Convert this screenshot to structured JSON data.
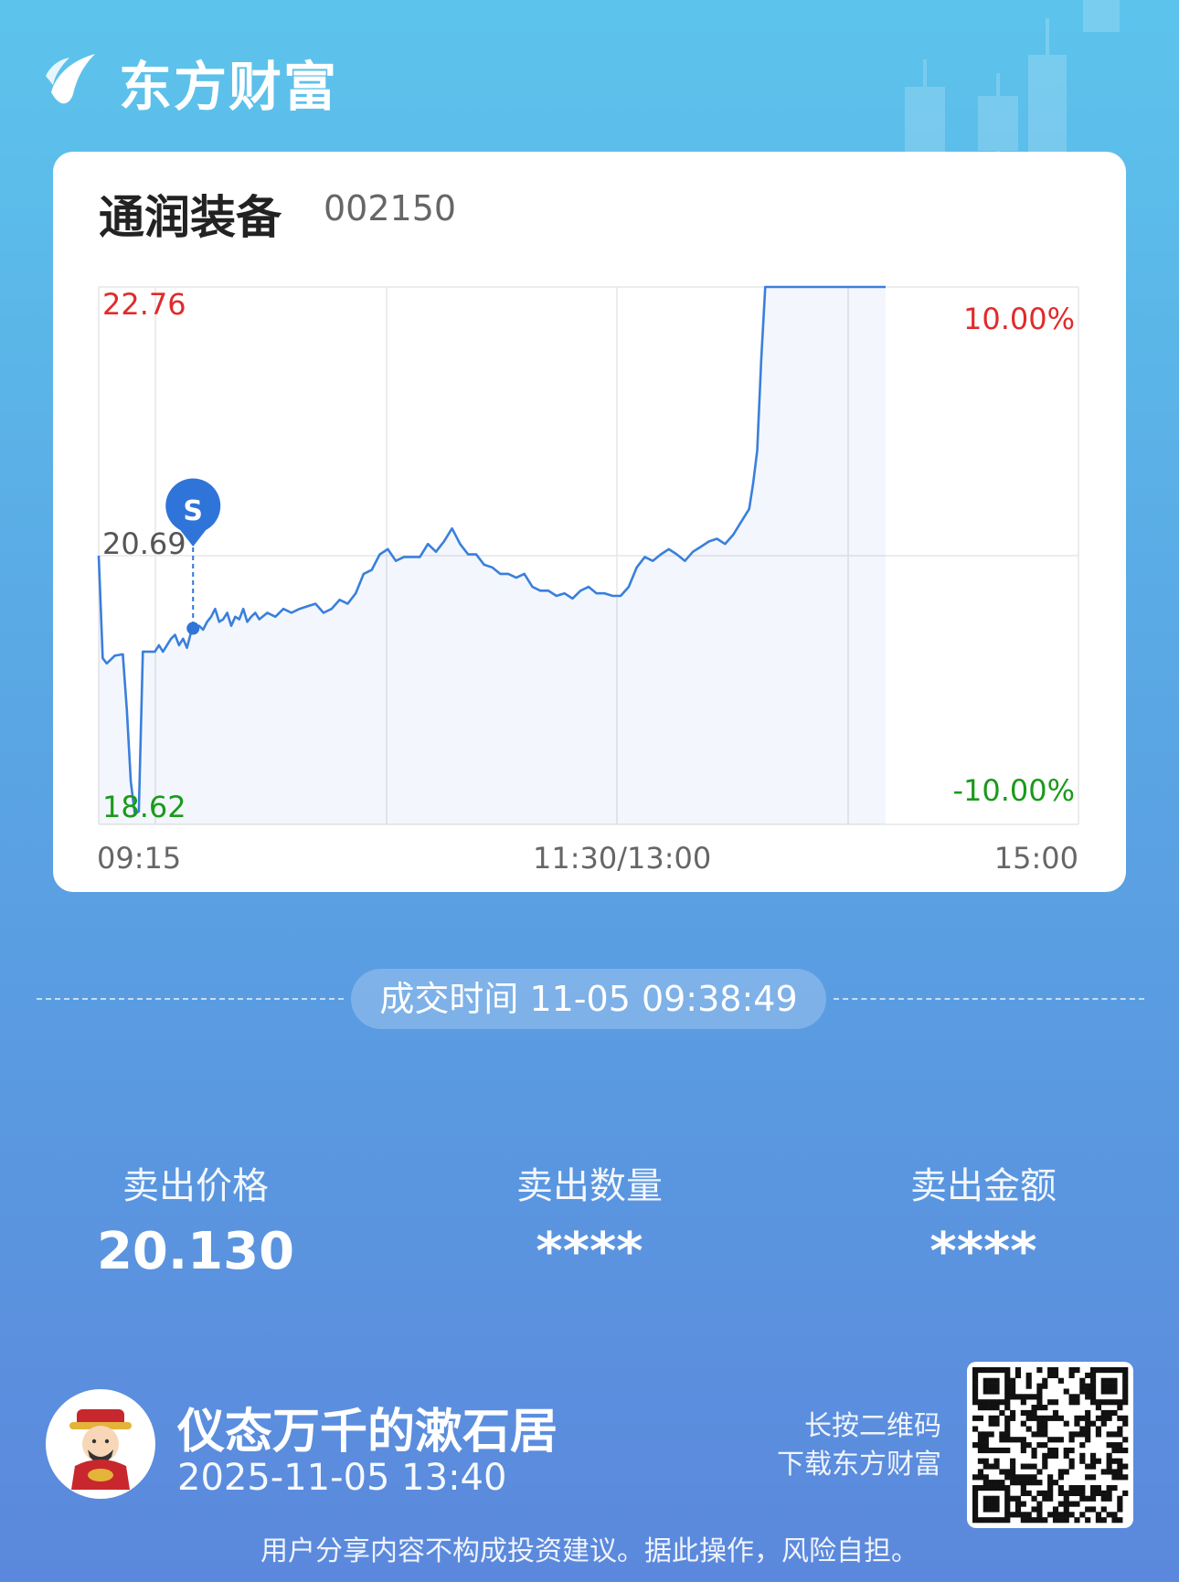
{
  "brand": {
    "name": "东方财富",
    "logo_icon": "eastmoney-logo-icon"
  },
  "stock": {
    "name": "通润装备",
    "code": "002150"
  },
  "chart_data": {
    "type": "line",
    "title": "",
    "price_axis": {
      "high": "22.76",
      "mid": "20.69",
      "low": "18.62"
    },
    "pct_axis": {
      "high": "10.00%",
      "low": "-10.00%"
    },
    "ylim": [
      18.62,
      22.76
    ],
    "x_labels": [
      "09:15",
      "11:30/13:00",
      "15:00"
    ],
    "sell_marker": {
      "label": "S",
      "time": "09:38",
      "price": 20.13
    },
    "series": [
      {
        "values": [
          [
            0,
            20.69
          ],
          [
            1,
            19.9
          ],
          [
            2,
            19.86
          ],
          [
            4,
            19.92
          ],
          [
            6,
            19.93
          ],
          [
            7,
            19.5
          ],
          [
            8,
            18.95
          ],
          [
            9,
            18.7
          ],
          [
            10,
            18.72
          ],
          [
            11,
            19.95
          ],
          [
            13,
            19.95
          ],
          [
            14,
            19.95
          ],
          [
            15,
            20.0
          ],
          [
            16,
            19.95
          ],
          [
            18,
            20.05
          ],
          [
            19,
            20.08
          ],
          [
            20,
            20.0
          ],
          [
            21,
            20.05
          ],
          [
            22,
            19.98
          ],
          [
            23,
            20.1
          ],
          [
            25,
            20.15
          ],
          [
            26,
            20.12
          ],
          [
            27,
            20.18
          ],
          [
            28,
            20.22
          ],
          [
            29,
            20.28
          ],
          [
            30,
            20.18
          ],
          [
            31,
            20.2
          ],
          [
            32,
            20.25
          ],
          [
            33,
            20.15
          ],
          [
            34,
            20.22
          ],
          [
            35,
            20.2
          ],
          [
            36,
            20.28
          ],
          [
            37,
            20.18
          ],
          [
            38,
            20.22
          ],
          [
            39,
            20.25
          ],
          [
            40,
            20.2
          ],
          [
            42,
            20.25
          ],
          [
            44,
            20.22
          ],
          [
            46,
            20.28
          ],
          [
            48,
            20.25
          ],
          [
            50,
            20.28
          ],
          [
            52,
            20.3
          ],
          [
            54,
            20.32
          ],
          [
            56,
            20.25
          ],
          [
            58,
            20.28
          ],
          [
            60,
            20.35
          ],
          [
            62,
            20.32
          ],
          [
            64,
            20.4
          ],
          [
            66,
            20.55
          ],
          [
            68,
            20.58
          ],
          [
            70,
            20.7
          ],
          [
            72,
            20.74
          ],
          [
            74,
            20.65
          ],
          [
            76,
            20.68
          ],
          [
            80,
            20.68
          ],
          [
            82,
            20.78
          ],
          [
            84,
            20.72
          ],
          [
            86,
            20.8
          ],
          [
            88,
            20.9
          ],
          [
            90,
            20.78
          ],
          [
            92,
            20.7
          ],
          [
            94,
            20.7
          ],
          [
            96,
            20.62
          ],
          [
            98,
            20.6
          ],
          [
            100,
            20.55
          ],
          [
            102,
            20.55
          ],
          [
            104,
            20.52
          ],
          [
            106,
            20.55
          ],
          [
            108,
            20.45
          ],
          [
            110,
            20.42
          ],
          [
            112,
            20.42
          ],
          [
            114,
            20.38
          ],
          [
            116,
            20.4
          ],
          [
            118,
            20.36
          ],
          [
            120,
            20.42
          ],
          [
            122,
            20.45
          ],
          [
            124,
            20.4
          ],
          [
            126,
            20.4
          ],
          [
            128,
            20.38
          ],
          [
            130,
            20.38
          ],
          [
            132,
            20.45
          ],
          [
            134,
            20.6
          ],
          [
            136,
            20.68
          ],
          [
            138,
            20.65
          ],
          [
            140,
            20.7
          ],
          [
            142,
            20.74
          ],
          [
            144,
            20.7
          ],
          [
            146,
            20.65
          ],
          [
            148,
            20.72
          ],
          [
            150,
            20.76
          ],
          [
            152,
            20.8
          ],
          [
            154,
            20.82
          ],
          [
            156,
            20.78
          ],
          [
            158,
            20.85
          ],
          [
            160,
            20.95
          ],
          [
            162,
            21.05
          ],
          [
            163,
            21.25
          ],
          [
            164,
            21.5
          ],
          [
            165,
            22.2
          ],
          [
            166,
            22.76
          ],
          [
            175,
            22.76
          ],
          [
            185,
            22.76
          ],
          [
            196,
            22.76
          ]
        ]
      }
    ]
  },
  "trade": {
    "time_label": "成交时间 11-05 09:38:49"
  },
  "stats": [
    {
      "label": "卖出价格",
      "value": "20.130"
    },
    {
      "label": "卖出数量",
      "value": "****"
    },
    {
      "label": "卖出金额",
      "value": "****"
    }
  ],
  "user": {
    "name": "仪态万千的漱石居",
    "share_time": "2025-11-05 13:40",
    "avatar_icon": "god-of-wealth-avatar-icon"
  },
  "qr": {
    "tip_line1": "长按二维码",
    "tip_line2": "下载东方财富"
  },
  "disclaimer": "用户分享内容不构成投资建议。据此操作，风险自担。",
  "colors": {
    "up": "#e02b2b",
    "down": "#1a9a1a",
    "line": "#3a7fdc",
    "marker": "#2f74d8"
  }
}
